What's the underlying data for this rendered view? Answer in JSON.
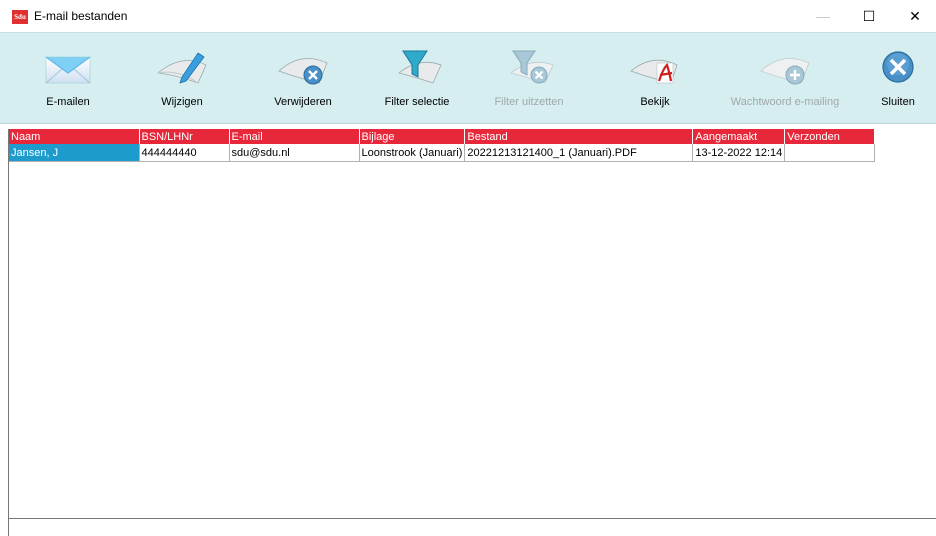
{
  "window": {
    "logo_text": "Sdu",
    "title": "E-mail bestanden",
    "minimize": "—",
    "maximize": "☐",
    "close": "✕"
  },
  "toolbar": {
    "email": "E-mailen",
    "edit": "Wijzigen",
    "delete": "Verwijderen",
    "filter": "Filter selectie",
    "filter_off": "Filter uitzetten",
    "view": "Bekijk",
    "password": "Wachtwoord e-mailing",
    "close": "Sluiten"
  },
  "table": {
    "columns": [
      "Naam",
      "BSN/LHNr",
      "E-mail",
      "Bijlage",
      "Bestand",
      "Aangemaakt",
      "Verzonden"
    ],
    "rows": [
      [
        "Jansen, J",
        "444444440",
        "sdu@sdu.nl",
        "Loonstrook (Januari)",
        "20221213121400_1 (Januari).PDF",
        "13-12-2022 12:14",
        ""
      ]
    ]
  },
  "colors": {
    "toolbar_bg": "#d6eef0",
    "header_bg": "#e6283a",
    "selected_bg": "#1d9bcc"
  }
}
